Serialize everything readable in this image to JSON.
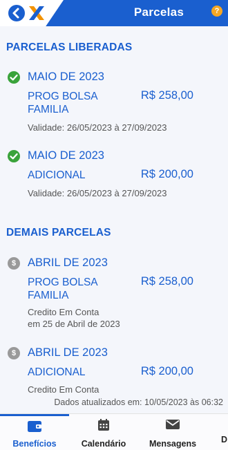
{
  "header": {
    "title": "Parcelas",
    "help_symbol": "?"
  },
  "sections": {
    "released_title": "PARCELAS LIBERADAS",
    "others_title": "DEMAIS PARCELAS"
  },
  "released": [
    {
      "month": "MAIO DE 2023",
      "description": "PROG BOLSA FAMILIA",
      "amount": "R$ 258,00",
      "validity": "Validade: 26/05/2023 à 27/09/2023"
    },
    {
      "month": "MAIO DE 2023",
      "description": "ADICIONAL",
      "amount": "R$ 200,00",
      "validity": "Validade: 26/05/2023 à 27/09/2023"
    }
  ],
  "others": [
    {
      "month": "ABRIL DE 2023",
      "description": "PROG BOLSA FAMILIA",
      "amount": "R$ 258,00",
      "status": "Credito Em Conta",
      "date": "em 25 de Abril de 2023"
    },
    {
      "month": "ABRIL DE 2023",
      "description": "ADICIONAL",
      "amount": "R$ 200,00",
      "status": "Credito Em Conta"
    }
  ],
  "updated_text": "Dados atualizados em: 10/05/2023 às 06:32",
  "nav": [
    {
      "label": "Benefícios",
      "icon": "wallet-icon",
      "active": true
    },
    {
      "label": "Calendário",
      "icon": "calendar-icon"
    },
    {
      "label": "Mensagens",
      "icon": "envelope-icon"
    },
    {
      "label": "D"
    }
  ],
  "colors": {
    "brand_blue": "#1a5fcf",
    "success_green": "#3aa33b",
    "logo_orange": "#f39200",
    "help_orange": "#f5a623"
  }
}
